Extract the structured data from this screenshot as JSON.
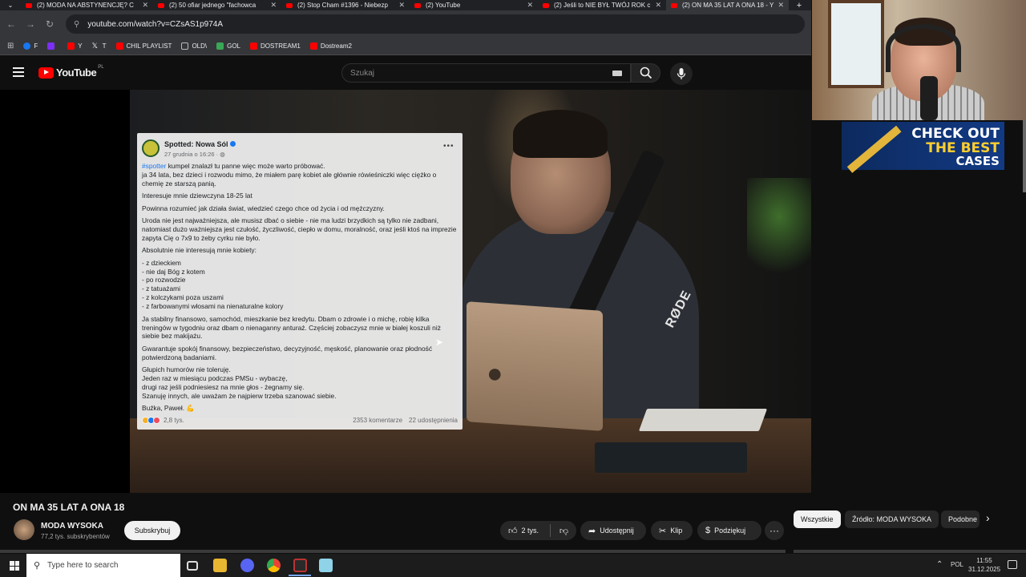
{
  "browser": {
    "tabs": [
      {
        "label": "(2) MODA NA ABSTYNENCJĘ? C",
        "active": false
      },
      {
        "label": "(2) 50 ofiar jednego \"fachowca",
        "active": false
      },
      {
        "label": "(2) Stop Cham #1396 - Niebezp",
        "active": false
      },
      {
        "label": "(2) YouTube",
        "active": false
      },
      {
        "label": "(2) Jeśli to NIE BYŁ TWÓJ ROK c",
        "active": false
      },
      {
        "label": "(2) ON MA 35 LAT A ONA 18 - Y",
        "active": true
      }
    ],
    "new_tab": "+",
    "url": "youtube.com/watch?v=CZsAS1p974A",
    "bookmarks": [
      {
        "label": "F",
        "color": "#1877f2"
      },
      {
        "label": "",
        "color": "#7b2ff7"
      },
      {
        "label": "Y",
        "color": "#ff0000"
      },
      {
        "label": "T",
        "color": "#ffffff"
      },
      {
        "label": "CHIL PLAYLIST",
        "color": "#ff0000"
      },
      {
        "label": "OLD\\",
        "color": "#888888"
      },
      {
        "label": "GOL",
        "color": "#3aa757"
      },
      {
        "label": "DOSTREAM1",
        "color": "#ff0000"
      },
      {
        "label": "Dostream2",
        "color": "#ff0000"
      }
    ]
  },
  "youtube": {
    "logo_text": "YouTube",
    "region": "PL",
    "search_placeholder": "Szukaj"
  },
  "post": {
    "page_name": "Spotted: Nowa Sól",
    "date": "27 grudnia o 16:26 · ",
    "hashtag": "#spotter",
    "paragraphs": [
      " kumpel znalazł tu panne więc może warto próbować.\nja 34 lata, bez dzieci i rozwodu mimo, że miałem parę kobiet ale głównie  rówieśniczki więc ciężko o chemię ze starszą panią.",
      "Interesuje mnie dziewczyna 18-25 lat",
      "Powinna rozumieć jak działa świat, wiedzieć czego chce od życia i od mężczyzny.",
      "Uroda nie jest najważniejsza, ale musisz dbać o siebie - nie ma ludzi brzydkich są tylko nie zadbani, natomiast dużo  ważniejsza jest czułość, życzliwość, ciepło w domu, moralność, oraz jeśli ktoś na imprezie zapyta Cię o 7x9 to żeby cyrku nie było.",
      "Absolutnie nie interesują mnie kobiety:",
      "- z dzieckiem\n- nie daj Bóg z kotem\n- po rozwodzie\n- z tatuażami\n- z kolczykami poza uszami\n- z farbowanymi włosami na nienaturalne kolory",
      "Ja stabilny finansowo, samochód, mieszkanie bez kredytu. Dbam o zdrowie i o michę, robię kilka treningów w tygodniu oraz dbam o nienaganny anturaż. Częściej zobaczysz mnie w białej koszuli niż siebie bez makijażu.",
      "Gwarantuje spokój finansowy, bezpieczeństwo, decyzyjność, męskość, planowanie oraz płodność potwierdzoną badaniami.",
      "Głupich humorów nie toleruję.\nJeden raz w miesiącu podczas PMSu - wybaczę,\ndrugi raz jeśli podniesiesz na mnie głos - żegnamy się.\nSzanuję innych, ale uważam że najpierw trzeba szanować siebie.",
      "Buźka, Paweł. 💪"
    ],
    "reactions": "2,8 tys.",
    "comments": "2353 komentarze",
    "shares": "22 udostępnienia"
  },
  "overlay": {
    "ad_line1": "CHECK OUT",
    "ad_line2": "THE BEST",
    "ad_line3": "CASES",
    "mic_brand": "RØDE"
  },
  "video": {
    "title": "ON MA 35 LAT A ONA 18",
    "channel": "MODA WYSOKA",
    "subscribers": "77,2 tys. subskrybentów",
    "subscribe": "Subskrybuj",
    "likes": "2 tys.",
    "share": "Udostępnij",
    "clip": "Klip",
    "thanks": "Podziękuj",
    "more": "···"
  },
  "chips": {
    "all": "Wszystkie",
    "source": "Źródło: MODA WYSOKA",
    "similar": "Podobne"
  },
  "taskbar": {
    "search_placeholder": "Type here to search",
    "lang": "POL",
    "time": "11:55",
    "date": "31.12.2025"
  }
}
